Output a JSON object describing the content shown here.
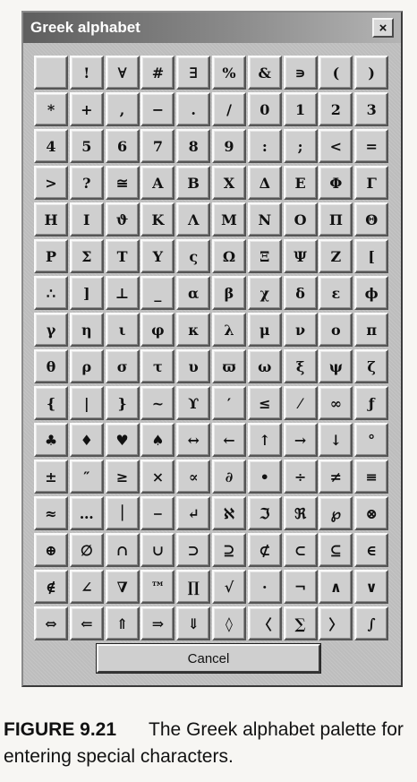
{
  "window": {
    "title": "Greek alphabet",
    "close_label": "×"
  },
  "palette": {
    "keys": [
      "",
      "!",
      "∀",
      "#",
      "∃",
      "%",
      "&",
      "∍",
      "(",
      ")",
      "*",
      "+",
      ",",
      "−",
      ".",
      "/",
      "0",
      "1",
      "2",
      "3",
      "4",
      "5",
      "6",
      "7",
      "8",
      "9",
      ":",
      ";",
      "<",
      "=",
      ">",
      "?",
      "≅",
      "Α",
      "Β",
      "Χ",
      "Δ",
      "Ε",
      "Φ",
      "Γ",
      "Η",
      "Ι",
      "ϑ",
      "Κ",
      "Λ",
      "Μ",
      "Ν",
      "Ο",
      "Π",
      "Θ",
      "Ρ",
      "Σ",
      "Τ",
      "Υ",
      "ς",
      "Ω",
      "Ξ",
      "Ψ",
      "Ζ",
      "[",
      "∴",
      "]",
      "⊥",
      "_",
      "α",
      "β",
      "χ",
      "δ",
      "ε",
      "ϕ",
      "γ",
      "η",
      "ι",
      "φ",
      "κ",
      "λ",
      "μ",
      "ν",
      "ο",
      "π",
      "θ",
      "ρ",
      "σ",
      "τ",
      "υ",
      "ϖ",
      "ω",
      "ξ",
      "ψ",
      "ζ",
      "{",
      "|",
      "}",
      "~",
      "ϒ",
      "′",
      "≤",
      "⁄",
      "∞",
      "ƒ",
      "♣",
      "♦",
      "♥",
      "♠",
      "↔",
      "←",
      "↑",
      "→",
      "↓",
      "°",
      "±",
      "″",
      "≥",
      "×",
      "∝",
      "∂",
      "•",
      "÷",
      "≠",
      "≡",
      "≈",
      "…",
      "⏐",
      "⎯",
      "↵",
      "ℵ",
      "ℑ",
      "ℜ",
      "℘",
      "⊗",
      "⊕",
      "∅",
      "∩",
      "∪",
      "⊃",
      "⊇",
      "⊄",
      "⊂",
      "⊆",
      "∈",
      "∉",
      "∠",
      "∇",
      "™",
      "∏",
      "√",
      "⋅",
      "¬",
      "∧",
      "∨",
      "⇔",
      "⇐",
      "⇑",
      "⇒",
      "⇓",
      "◊",
      "〈",
      "∑",
      "〉",
      "∫"
    ],
    "cancel_label": "Cancel"
  },
  "caption": {
    "figure_label": "FIGURE 9.21",
    "text": "The Greek alphabet palette for entering special characters."
  }
}
